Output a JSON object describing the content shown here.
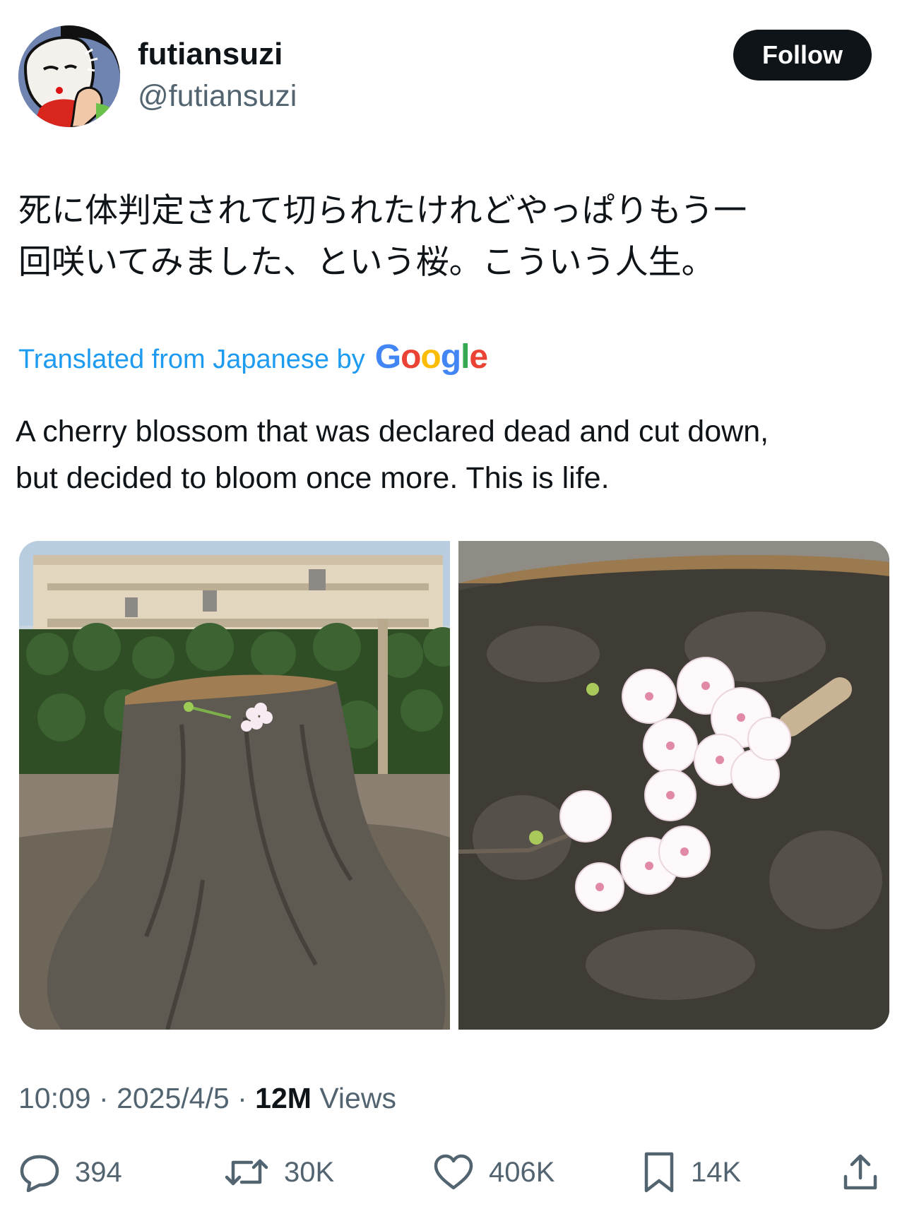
{
  "post": {
    "display_name": "futiansuzi",
    "handle": "@futiansuzi",
    "follow_label": "Follow",
    "text_original_lines": [
      "死に体判定されて切られたけれどやっぱりもう一",
      "回咲いてみました、という桜。こういう人生。"
    ],
    "translated_label": "Translated from Japanese by",
    "translator_logo_text": "Google",
    "text_translated_lines": [
      "A cherry blossom that was declared dead and cut down,",
      "but decided to bloom once more. This is life."
    ],
    "time": "10:09",
    "date": "2025/4/5",
    "views_count": "12M",
    "views_label": "Views",
    "separator": "·"
  },
  "actions": {
    "replies": "394",
    "reposts": "30K",
    "likes": "406K",
    "bookmarks": "14K"
  },
  "icons": {
    "reply": "speech-bubble-icon",
    "repost": "repost-arrows-icon",
    "like": "heart-icon",
    "bookmark": "bookmark-icon",
    "share": "share-upload-icon"
  },
  "colors": {
    "text": "#0f1419",
    "secondary": "#536471",
    "link": "#1d9bf0",
    "button_bg": "#0f1419",
    "button_text": "#ffffff"
  }
}
